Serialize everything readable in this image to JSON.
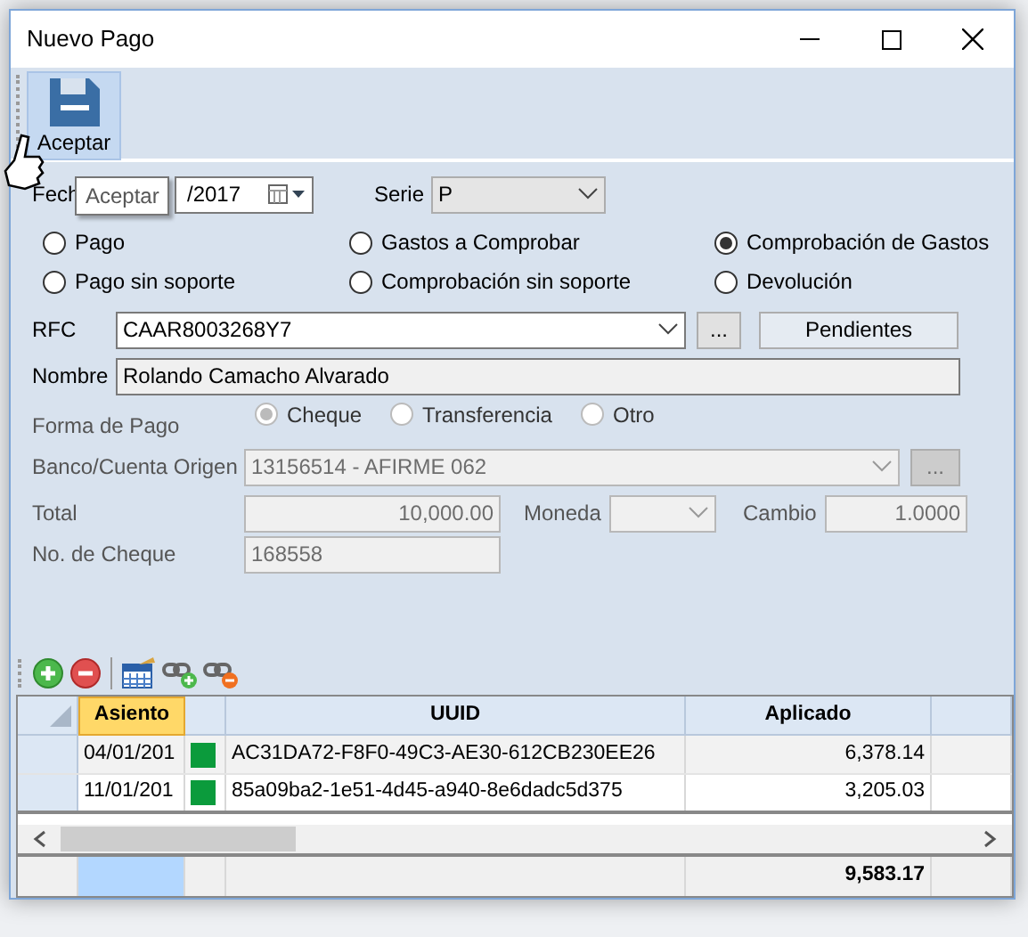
{
  "window": {
    "title": "Nuevo Pago"
  },
  "toolbar": {
    "buttons": [
      {
        "label": "Aceptar",
        "hovered": true
      }
    ]
  },
  "tooltip": "Aceptar",
  "form": {
    "fecha": {
      "label": "Fech",
      "value": "/2017"
    },
    "serie": {
      "label": "Serie",
      "value": "P"
    },
    "tipo_options": [
      {
        "label": "Pago",
        "selected": false
      },
      {
        "label": "Gastos a Comprobar",
        "selected": false
      },
      {
        "label": "Comprobación de Gastos",
        "selected": true
      },
      {
        "label": "Pago sin soporte",
        "selected": false
      },
      {
        "label": "Comprobación sin soporte",
        "selected": false
      },
      {
        "label": "Devolución",
        "selected": false
      }
    ],
    "rfc": {
      "label": "RFC",
      "value": "CAAR8003268Y7"
    },
    "rfc_buttons": [
      "...",
      "Pendientes"
    ],
    "nombre": {
      "label": "Nombre",
      "value": "Rolando Camacho Alvarado"
    },
    "forma_de_pago": {
      "label": "Forma de Pago",
      "disabled": true,
      "options": [
        {
          "label": "Cheque",
          "selected": true
        },
        {
          "label": "Transferencia",
          "selected": false
        },
        {
          "label": "Otro",
          "selected": false
        }
      ]
    },
    "banco": {
      "label": "Banco/Cuenta Origen",
      "value": "13156514 - AFIRME  062",
      "button": "..."
    },
    "total": {
      "label": "Total",
      "value": "10,000.00"
    },
    "moneda": {
      "label": "Moneda"
    },
    "cambio": {
      "label": "Cambio",
      "value": "1.0000"
    },
    "no_cheque": {
      "label": "No. de Cheque",
      "value": "168558"
    }
  },
  "grid": {
    "columns": [
      {
        "label": "Asiento",
        "selected": true
      },
      {
        "label": "UUID",
        "selected": false
      },
      {
        "label": "Aplicado",
        "selected": false
      }
    ],
    "rows": [
      {
        "asiento": "04/01/201",
        "color": "#0b9b3c",
        "uuid": "AC31DA72-F8F0-49C3-AE30-612CB230EE26",
        "aplicado": "6,378.14"
      },
      {
        "asiento": "11/01/201",
        "color": "#0b9b3c",
        "uuid": "85a09ba2-1e51-4d45-a940-8e6dadc5d375",
        "aplicado": "3,205.03"
      }
    ],
    "footer_total": "9,583.17"
  }
}
